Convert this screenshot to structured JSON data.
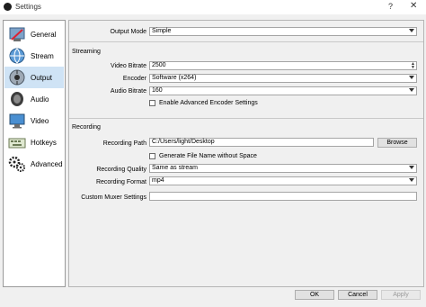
{
  "window": {
    "title": "Settings",
    "help_glyph": "?",
    "close_glyph": "✕"
  },
  "sidebar": {
    "items": [
      {
        "label": "General",
        "icon": "general-icon"
      },
      {
        "label": "Stream",
        "icon": "stream-icon"
      },
      {
        "label": "Output",
        "icon": "output-icon",
        "active": true
      },
      {
        "label": "Audio",
        "icon": "audio-icon"
      },
      {
        "label": "Video",
        "icon": "video-icon"
      },
      {
        "label": "Hotkeys",
        "icon": "hotkeys-icon"
      },
      {
        "label": "Advanced",
        "icon": "advanced-icon"
      }
    ]
  },
  "output_mode": {
    "label": "Output Mode",
    "value": "Simple"
  },
  "streaming": {
    "title": "Streaming",
    "video_bitrate": {
      "label": "Video Bitrate",
      "value": "2500"
    },
    "encoder": {
      "label": "Encoder",
      "value": "Software (x264)"
    },
    "audio_bitrate": {
      "label": "Audio Bitrate",
      "value": "160"
    },
    "advanced_encoder": {
      "label": "Enable Advanced Encoder Settings",
      "checked": false
    }
  },
  "recording": {
    "title": "Recording",
    "path": {
      "label": "Recording Path",
      "value": "C:/Users/light/Desktop"
    },
    "browse_label": "Browse",
    "no_space": {
      "label": "Generate File Name without Space",
      "checked": false
    },
    "quality": {
      "label": "Recording Quality",
      "value": "Same as stream"
    },
    "format": {
      "label": "Recording Format",
      "value": "mp4"
    },
    "muxer": {
      "label": "Custom Muxer Settings",
      "value": ""
    }
  },
  "footer": {
    "ok": "OK",
    "cancel": "Cancel",
    "apply": "Apply"
  },
  "colors": {
    "active_item": "#cfe3f5",
    "window_bg": "#f0f0f0"
  }
}
